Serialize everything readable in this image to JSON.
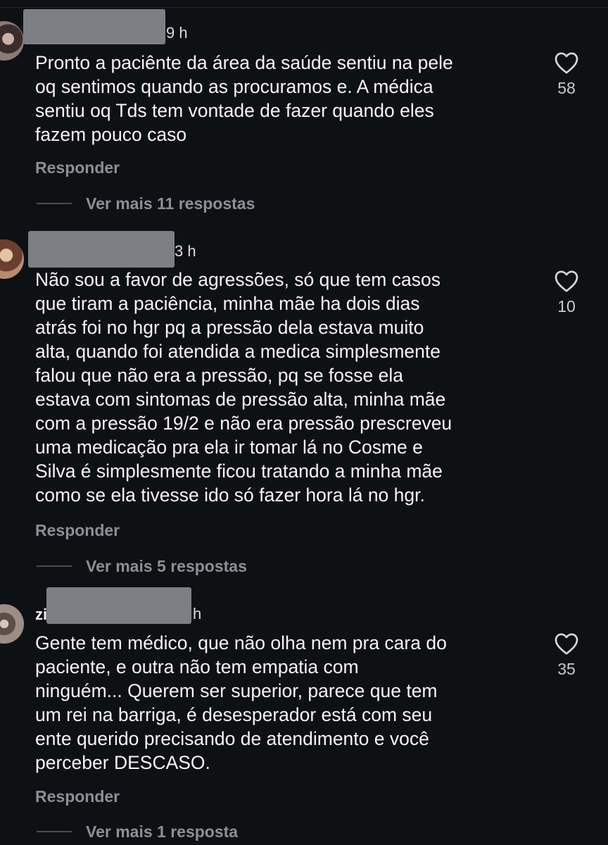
{
  "comments": [
    {
      "time": "9 h",
      "text_lines": [
        "Pronto a paciênte da área da saúde sentiu na pele",
        "oq sentimos quando as procuramos e. A médica",
        "sentiu oq Tds tem vontade de fazer quando eles",
        "fazem pouco caso"
      ],
      "reply_label": "Responder",
      "more_replies": "Ver mais 11 respostas",
      "likes": "58"
    },
    {
      "time": "3 h",
      "text_lines": [
        "Não sou a favor de agressões, só que tem casos",
        "que tiram a paciência, minha mãe ha dois dias",
        "atrás foi no hgr pq a pressão dela estava muito",
        "alta, quando foi atendida a medica simplesmente",
        "falou que não era a pressão, pq se fosse ela",
        "estava com sintomas de pressão alta, minha mãe",
        "com a pressão 19/2 e não era pressão prescreveu",
        "uma medicação pra ela ir tomar lá no Cosme e",
        "Silva é simplesmente ficou tratando a minha mãe",
        "como se ela tivesse ido só fazer hora lá no hgr."
      ],
      "reply_label": "Responder",
      "more_replies": "Ver mais 5 respostas",
      "likes": "10"
    },
    {
      "username_prefix": "zi",
      "time": "h",
      "text_lines": [
        "Gente tem médico, que não olha nem pra cara do",
        "paciente, e outra não tem empatia com",
        "ninguém... Querem ser superior, parece que tem",
        "um rei na barriga, é desesperador está com seu",
        "ente querido precisando de atendimento e você",
        "perceber DESCASO."
      ],
      "reply_label": "Responder",
      "more_replies": "Ver mais 1 resposta",
      "likes": "35"
    }
  ],
  "icons": {
    "like": "heart-outline-icon",
    "avatar": "profile-photo"
  },
  "colors": {
    "background": "#0f1014",
    "text": "#f4f4f4",
    "muted": "#8d8f95",
    "redaction": "#7d7f85"
  }
}
